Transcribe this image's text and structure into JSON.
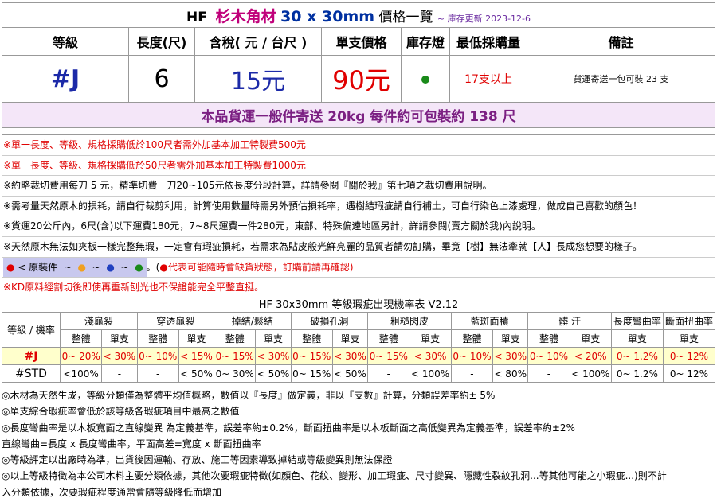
{
  "title": {
    "brand": "HF",
    "name": "杉木角材",
    "size": "30 x 30mm",
    "suffix": "價格一覽",
    "update": "~ 庫存更新 2023-12-6"
  },
  "headers": [
    "等級",
    "長度(尺)",
    "含稅( 元 / 台尺 )",
    "單支價格",
    "庫存燈",
    "最低採購量",
    "備註"
  ],
  "product": {
    "grade": "#J",
    "length": "6",
    "price_per_ft": "15元",
    "unit_price": "90元",
    "stock": "in-stock",
    "min_qty": "17支以上",
    "remark": "貨運寄送一包可裝 23 支"
  },
  "shipping": "本品貨運一般件寄送 20kg 每件約可包裝約 138 尺",
  "notes": [
    "※單一長度、等級、規格採購低於100尺者需外加基本加工特製費500元",
    "※單一長度、等級、規格採購低於50尺者需外加基本加工特製費1000元",
    "※約略裁切費用每刀 5 元，精準切費一刀20~105元依長度分段計算，詳請參閱『關於我』第七項之裁切費用說明。",
    "※需考量天然原木的損耗，請自行裁剪利用，計算使用數量時需另外預估損耗率，遇樹結瑕疵請自行補土，可自行染色上漆處理，做成自己喜歡的顏色！",
    "※貨運20公斤內，6尺(含)以下運費180元，7~8尺運費一件280元，東部、特殊偏遠地區另計，詳請參閱(賣方關於我)內說明。",
    "※天然原木無法如夾板一樣完整無瑕，一定會有瑕疵損耗，若需求為貼皮般光鮮亮麗的品質者請勿訂購，畢竟【樹】無法牽就【人】長成您想要的樣子。",
    "※KD原料經割切後即使再重新刨光也不保證能完全平整直挺。"
  ],
  "stock_legend": {
    "label": "< 原裝件",
    "sep": "~",
    "note": "代表可能隨時會缺貨狀態，訂購前請再確認)",
    "paren": "。("
  },
  "colors": {
    "red": "#e00000",
    "green": "#1a8a1a",
    "orange": "#f0a020",
    "blue": "#2040c0"
  },
  "defect_table": {
    "title": "HF 30x30mm 等級瑕疵出現機率表 V2.12",
    "row_header": "等級 / 機率",
    "groups": [
      "淺龜裂",
      "穿透龜裂",
      "掉結/鬆結",
      "破損孔洞",
      "粗糙閃皮",
      "藍斑面積",
      "髒 汙",
      "長度彎曲率",
      "斷面扭曲率"
    ],
    "sub": [
      "整體",
      "單支"
    ],
    "sub_single": "單支",
    "rows": [
      {
        "grade": "#J",
        "cells": [
          "0~ 20%",
          "< 30%",
          "0~ 10%",
          "< 15%",
          "0~ 15%",
          "< 30%",
          "0~ 15%",
          "< 30%",
          "0~ 15%",
          "< 30%",
          "0~ 10%",
          "< 30%",
          "0~ 10%",
          "< 20%",
          "0~ 1.2%",
          "0~ 12%"
        ]
      },
      {
        "grade": "#STD",
        "cells": [
          "<100%",
          "-",
          "-",
          "< 50%",
          "0~ 30%",
          "< 50%",
          "0~ 15%",
          "< 50%",
          "-",
          "< 100%",
          "-",
          "< 80%",
          "-",
          "< 100%",
          "0~ 1.2%",
          "0~ 12%"
        ]
      }
    ]
  },
  "footnotes": [
    "◎木材為天然生成，等級分類僅為整體平均值概略，數值以『長度』做定義，非以『支數』計算，分類誤差率約± 5%",
    "◎單支綜合瑕疵率會低於該等級各瑕疵項目中最高之數值",
    "◎長度彎曲率是以木板寬面之直線變異 為定義基準，誤差率約±0.2%，斷面扭曲率是以木板斷面之高低變異為定義基準，誤差率約±2%",
    "直線彎曲=長度 x 長度彎曲率，平面高差=寬度 x 斷面扭曲率",
    "◎等級評定以出廠時為準，出貨後因運輸、存放、施工等因素導致掉結或等級變異則無法保證",
    "◎以上等級特徵為本公司木料主要分類依據，其他次要瑕疵特徵(如顏色、花紋、變形、加工瑕疵、尺寸變異、隱藏性裂紋孔洞...等其他可能之小瑕疵...)則不計",
    "入分類依據，次要瑕疵程度通常會隨等級降低而增加"
  ]
}
